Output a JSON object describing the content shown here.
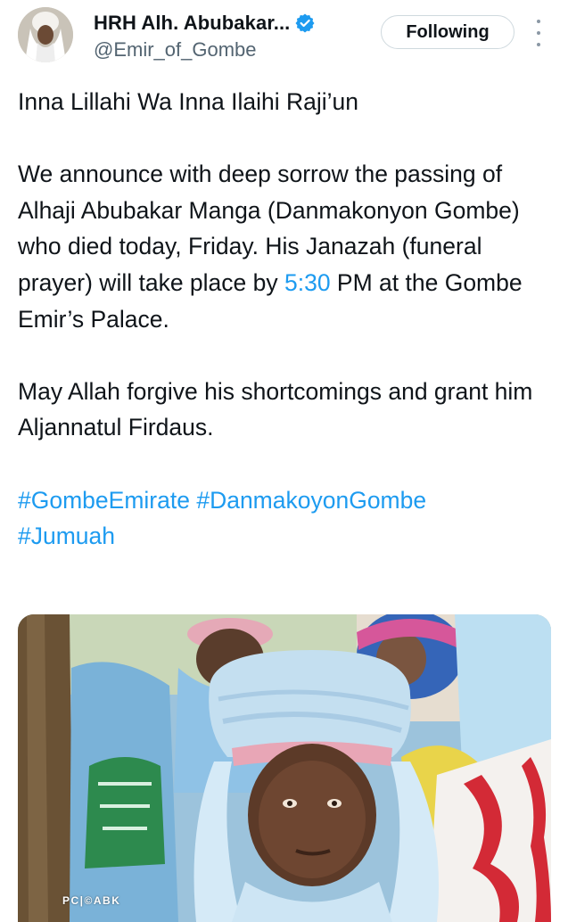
{
  "author": {
    "display_name": "HRH Alh. Abubakar...",
    "handle": "@Emir_of_Gombe",
    "verified": true,
    "avatar_icon": "profile-photo"
  },
  "header": {
    "follow_label": "Following",
    "more_icon": "more-vertical-icon"
  },
  "tweet": {
    "line1": "Inna Lillahi Wa Inna Ilaihi Raji’un",
    "para2_a": "We announce with deep sorrow the passing of Alhaji Abubakar Manga (Danmakonyon Gombe) who died today, Friday. His Janazah (funeral prayer) will take place by ",
    "para2_time": "5:30",
    "para2_b": " PM at the Gombe Emir’s Palace.",
    "para3": "May Allah forgive his shortcomings and grant him Aljannatul Firdaus.",
    "hashtags": [
      "#GombeEmirate",
      "#DanmakoyonGombe",
      "#Jumuah"
    ]
  },
  "media": {
    "watermark": "PC|©ABK"
  },
  "colors": {
    "text": "#0f1419",
    "secondary": "#536471",
    "link": "#1d9bf0",
    "verified_badge": "#1d9bf0",
    "button_border": "#cfd9de"
  }
}
